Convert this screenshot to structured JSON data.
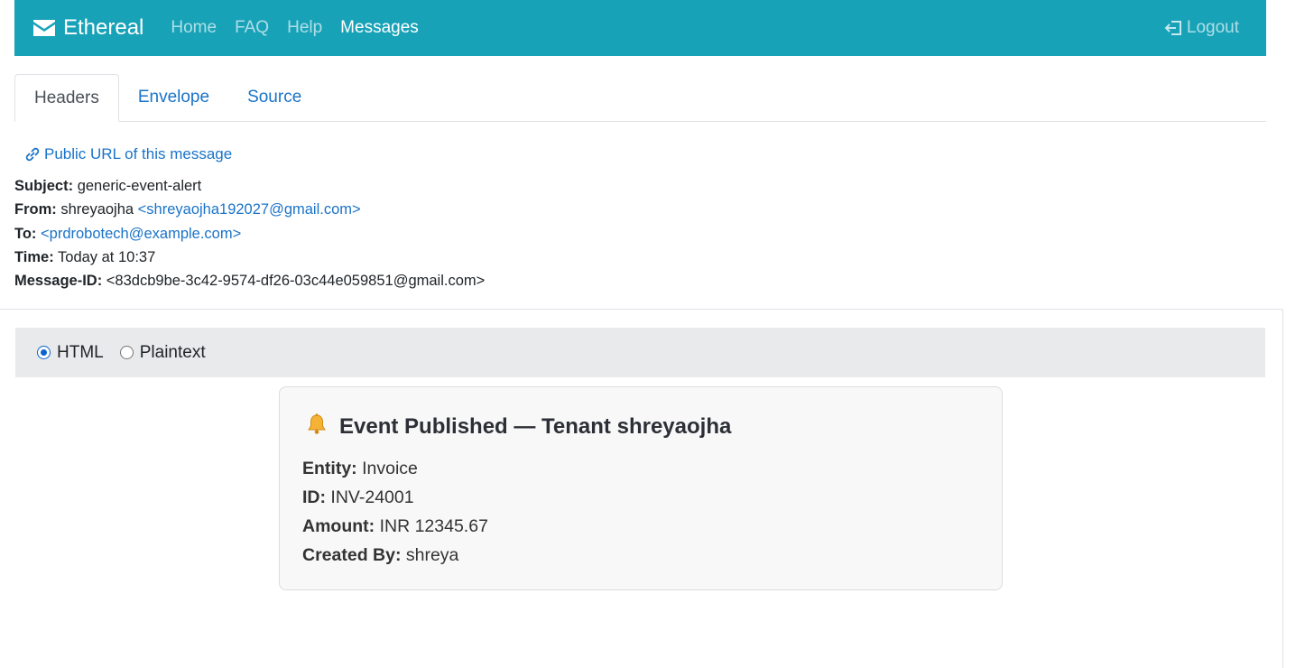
{
  "navbar": {
    "brand": "Ethereal",
    "links": [
      "Home",
      "FAQ",
      "Help",
      "Messages"
    ],
    "active_link": "Messages",
    "logout": "Logout"
  },
  "tabs": [
    "Headers",
    "Envelope",
    "Source"
  ],
  "active_tab": "Headers",
  "public_url_label": "Public URL of this message",
  "headers": {
    "subject_label": "Subject:",
    "subject": "generic-event-alert",
    "from_label": "From:",
    "from_name": "shreyaojha",
    "from_email": "<shreyaojha192027@gmail.com>",
    "to_label": "To:",
    "to_email": "<prdrobotech@example.com>",
    "time_label": "Time:",
    "time": "Today at 10:37",
    "message_id_label": "Message-ID:",
    "message_id": "<83dcb9be-3c42-9574-df26-03c44e059851@gmail.com>"
  },
  "format": {
    "options": [
      "HTML",
      "Plaintext"
    ],
    "selected": "HTML"
  },
  "email": {
    "icon": "bell-icon",
    "title": "Event Published — Tenant shreyaojha",
    "rows": [
      {
        "label": "Entity:",
        "value": "Invoice"
      },
      {
        "label": "ID:",
        "value": "INV-24001"
      },
      {
        "label": "Amount:",
        "value": "INR 12345.67"
      },
      {
        "label": "Created By:",
        "value": "shreya"
      }
    ]
  },
  "colors": {
    "navbar": "#17a2b8",
    "link": "#1a73c8",
    "format_bar": "#e9eaec"
  }
}
